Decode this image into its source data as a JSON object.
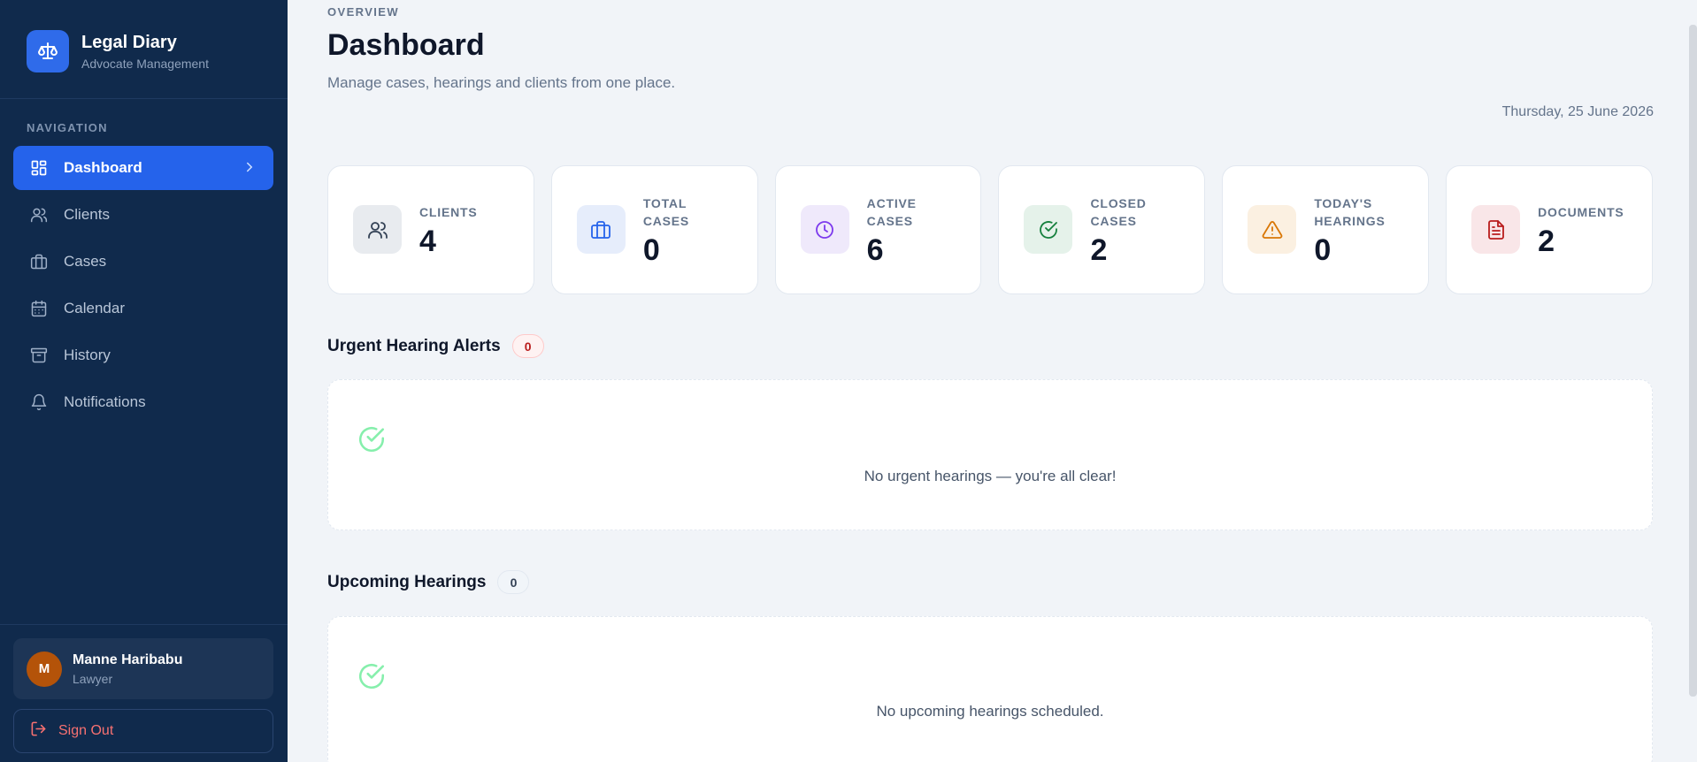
{
  "brand": {
    "title": "Legal Diary",
    "subtitle": "Advocate Management"
  },
  "nav": {
    "heading": "NAVIGATION",
    "items": [
      {
        "label": "Dashboard",
        "icon": "layout-grid-icon",
        "active": true
      },
      {
        "label": "Clients",
        "icon": "users-icon"
      },
      {
        "label": "Cases",
        "icon": "briefcase-icon"
      },
      {
        "label": "Calendar",
        "icon": "calendar-icon"
      },
      {
        "label": "History",
        "icon": "archive-icon"
      },
      {
        "label": "Notifications",
        "icon": "bell-icon"
      }
    ]
  },
  "user": {
    "initial": "M",
    "name": "Manne Haribabu",
    "role": "Lawyer"
  },
  "signout": {
    "label": "Sign Out"
  },
  "header": {
    "overline": "OVERVIEW",
    "title": "Dashboard",
    "subtitle": "Manage cases, hearings and clients from one place.",
    "date": "Thursday, 25 June 2026"
  },
  "stats": [
    {
      "label": "CLIENTS",
      "value": "4",
      "icon": "users-icon",
      "color": "#334155",
      "bg": "#e8ebef"
    },
    {
      "label": "TOTAL CASES",
      "value": "0",
      "icon": "briefcase-icon",
      "color": "#2563eb",
      "bg": "#e6edfb"
    },
    {
      "label": "ACTIVE CASES",
      "value": "6",
      "icon": "clock-icon",
      "color": "#7c3aed",
      "bg": "#efe9fb"
    },
    {
      "label": "CLOSED CASES",
      "value": "2",
      "icon": "check-circle-icon",
      "color": "#15803d",
      "bg": "#e5f2ea"
    },
    {
      "label": "TODAY'S HEARINGS",
      "value": "0",
      "icon": "warning-icon",
      "color": "#d97706",
      "bg": "#fbf0e1"
    },
    {
      "label": "DOCUMENTS",
      "value": "2",
      "icon": "document-icon",
      "color": "#b91c1c",
      "bg": "#f9e6e8"
    }
  ],
  "urgent": {
    "title": "Urgent Hearing Alerts",
    "count": "0",
    "empty_text": "No urgent hearings — you're all clear!"
  },
  "upcoming": {
    "title": "Upcoming Hearings",
    "count": "0",
    "empty_text": "No upcoming hearings scheduled."
  }
}
